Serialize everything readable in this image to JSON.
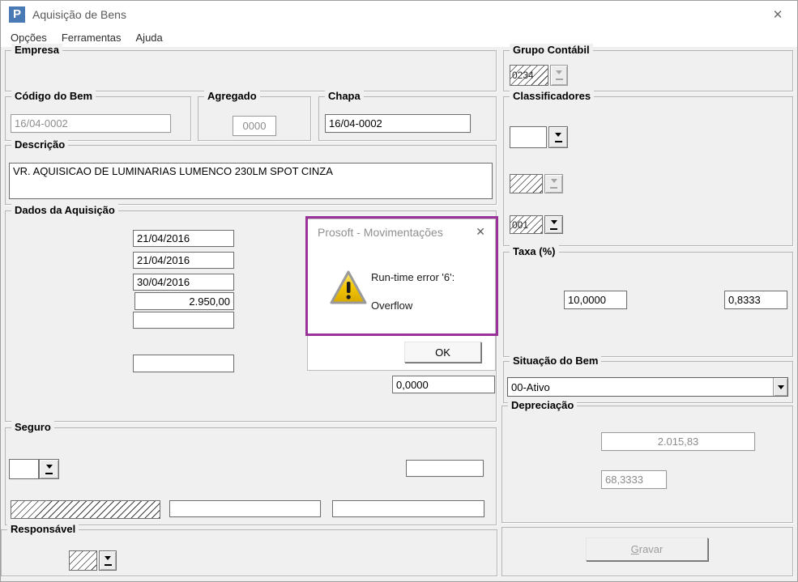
{
  "window": {
    "title": "Aquisição de Bens",
    "app_icon_letter": "P",
    "close_glyph": "✕"
  },
  "menu": {
    "items": [
      "Opções",
      "Ferramentas",
      "Ajuda"
    ]
  },
  "colors": {
    "annotation_purple": "#993399",
    "icon_blue": "#4a7ab5",
    "form_bg": "#f0f0f0",
    "warning_yellow": "#f2c500"
  },
  "groups": {
    "empresa": {
      "label": "Empresa"
    },
    "codigo": {
      "label": "Código do Bem",
      "value": "16/04-0002"
    },
    "agregado": {
      "label": "Agregado",
      "value": "0000"
    },
    "chapa": {
      "label": "Chapa",
      "value": "16/04-0002"
    },
    "descricao": {
      "label": "Descrição",
      "value": "VR. AQUISICAO DE LUMINARIAS LUMENCO 230LM SPOT CINZA"
    },
    "dados": {
      "label": "Dados da Aquisição",
      "fields": [
        "21/04/2016",
        "21/04/2016",
        "30/04/2016",
        "2.950,00",
        "",
        ""
      ],
      "bottom_value": "0,0000"
    },
    "seguro": {
      "label": "Seguro",
      "combo_value": "",
      "field_top": "",
      "field_mid": "",
      "field_right": ""
    },
    "responsavel": {
      "label": "Responsável",
      "code": ""
    },
    "grupo_contabil": {
      "label": "Grupo Contábil",
      "code": "0234"
    },
    "classificadores": {
      "label": "Classificadores",
      "codes": [
        "",
        "",
        "001"
      ]
    },
    "taxa": {
      "label": "Taxa (%)",
      "values": [
        "10,0000",
        "0,8333"
      ]
    },
    "situacao": {
      "label": "Situação do Bem",
      "selected": "00-Ativo"
    },
    "depreciacao": {
      "label": "Depreciação",
      "values": [
        "2.015,83",
        "68,3333"
      ]
    }
  },
  "gravar": {
    "accel": "G",
    "rest": "ravar"
  },
  "dialog": {
    "title": "Prosoft - Movimentações",
    "close_glyph": "✕",
    "line1": "Run-time error '6':",
    "line2": "Overflow",
    "ok": "OK"
  }
}
